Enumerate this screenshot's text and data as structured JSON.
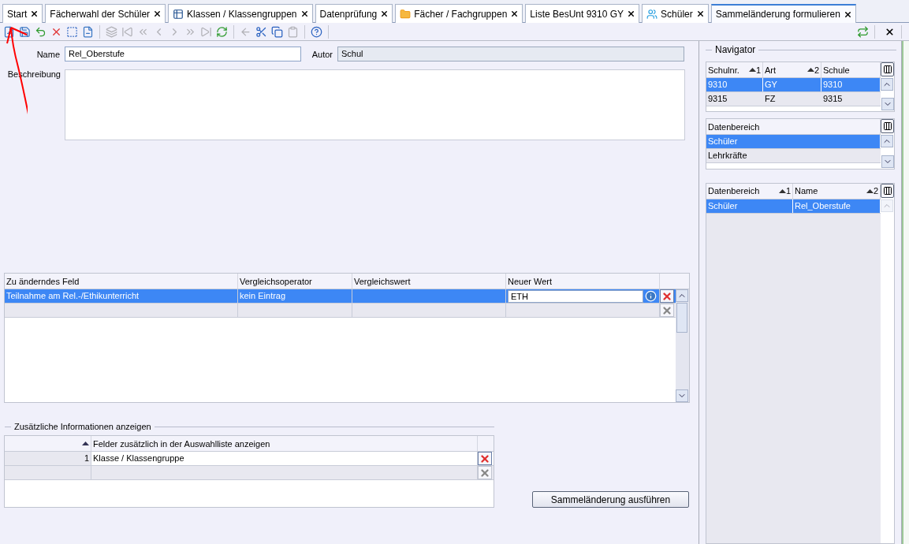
{
  "tabs": [
    {
      "label": "Start",
      "kind": "plain",
      "selected": false
    },
    {
      "label": "Fächerwahl der Schüler",
      "kind": "plain",
      "selected": false
    },
    {
      "label": "Klassen / Klassengruppen",
      "kind": "table",
      "selected": false
    },
    {
      "label": "Datenprüfung",
      "kind": "plain",
      "selected": false
    },
    {
      "label": "Fächer / Fachgruppen",
      "kind": "folder",
      "selected": false
    },
    {
      "label": "Liste BesUnt 9310 GY",
      "kind": "plain",
      "selected": false
    },
    {
      "label": "Schüler",
      "kind": "group",
      "selected": false
    },
    {
      "label": "Sammeländerung formulieren",
      "kind": "plain",
      "selected": true
    }
  ],
  "toolbar": [
    [
      {
        "disabled": false
      },
      {
        "disabled": false
      },
      {
        "disabled": false
      },
      {
        "disabled": false
      },
      {
        "disabled": false
      },
      {
        "disabled": false
      }
    ],
    [
      {
        "disabled": true
      },
      {
        "disabled": true
      },
      {
        "disabled": true
      },
      {
        "disabled": true
      },
      {
        "disabled": true
      },
      {
        "disabled": true
      },
      {
        "disabled": true
      },
      {
        "disabled": false
      }
    ],
    [
      {
        "disabled": true
      },
      {
        "disabled": false
      },
      {
        "disabled": false
      },
      {
        "disabled": true
      }
    ],
    [
      {
        "disabled": false
      }
    ]
  ],
  "form": {
    "name_label": "Name",
    "name_value": "Rel_Oberstufe",
    "author_label": "Autor",
    "author_value": "Schul",
    "description_label": "Beschreibung"
  },
  "changes_grid": {
    "columns": [
      "Zu änderndes Feld",
      "Vergleichsoperator",
      "Vergleichswert",
      "Neuer Wert"
    ],
    "rows": [
      {
        "kind": "entry",
        "selected": true,
        "field": "Teilnahme am Rel.-/Ethikunterricht",
        "operator": "kein Eintrag",
        "new_value": "ETH"
      },
      {
        "kind": "new",
        "selected": false
      }
    ]
  },
  "info_section": {
    "title": "Zusätzliche Informationen anzeigen",
    "columns": [
      "Felder zusätzlich in der Auswahlliste anzeigen"
    ],
    "rows": [
      {
        "kind": "entry",
        "number": "1",
        "field": "Klasse / Klassengruppe"
      },
      {
        "kind": "new"
      }
    ]
  },
  "execute_button": "Sammeländerung ausführen",
  "navigator": {
    "title": "Navigator",
    "grids": [
      {
        "columns": [
          {
            "label": "Schulnr.",
            "sort": "1"
          },
          {
            "label": "Art",
            "sort": "2"
          },
          {
            "label": "Schule"
          }
        ],
        "rows": [
          {
            "cells": [
              "9310",
              "GY",
              "9310"
            ],
            "selected": true
          },
          {
            "cells": [
              "9315",
              "FZ",
              "9315"
            ],
            "selected": false
          }
        ]
      },
      {
        "columns": [
          {
            "label": "Datenbereich"
          }
        ],
        "rows": [
          {
            "cells": [
              "Schüler"
            ],
            "selected": true
          },
          {
            "cells": [
              "Lehrkräfte"
            ],
            "selected": false
          }
        ]
      },
      {
        "columns": [
          {
            "label": "Datenbereich",
            "sort": "1"
          },
          {
            "label": "Name",
            "sort": "2"
          }
        ],
        "rows": [
          {
            "cells": [
              "Schüler",
              "Rel_Oberstufe"
            ],
            "selected": true
          }
        ]
      }
    ]
  }
}
